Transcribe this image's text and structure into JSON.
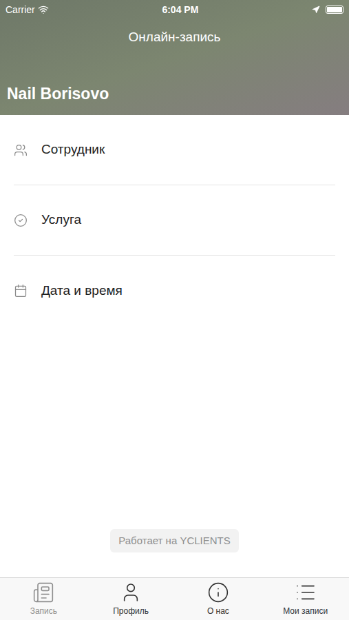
{
  "status_bar": {
    "carrier": "Carrier",
    "time": "6:04 PM"
  },
  "header": {
    "title": "Онлайн-запись",
    "company": "Nail Borisovo"
  },
  "menu": [
    {
      "label": "Сотрудник"
    },
    {
      "label": "Услуга"
    },
    {
      "label": "Дата и время"
    }
  ],
  "powered_by": "Работает на YCLIENTS",
  "tabs": [
    {
      "label": "Запись",
      "selected": true
    },
    {
      "label": "Профиль",
      "selected": false
    },
    {
      "label": "О нас",
      "selected": false
    },
    {
      "label": "Мои записи",
      "selected": false
    }
  ]
}
